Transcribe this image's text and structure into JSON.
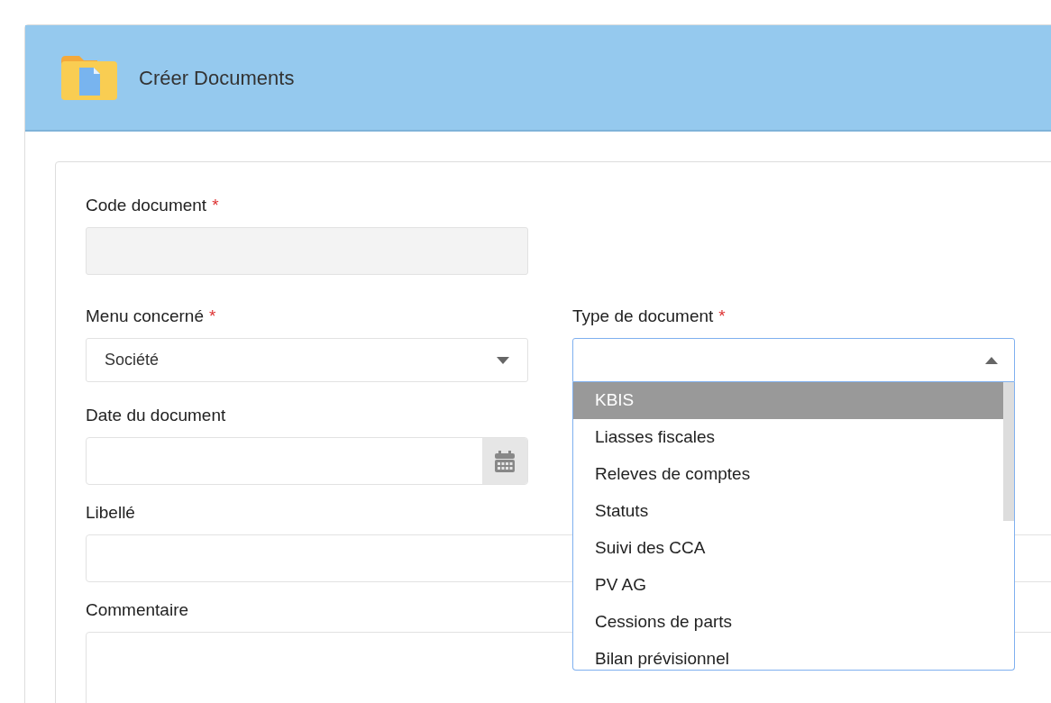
{
  "header": {
    "title": "Créer Documents"
  },
  "form": {
    "code_document": {
      "label": "Code document",
      "required_mark": "*",
      "disabled": true
    },
    "menu_concerne": {
      "label": "Menu concerné",
      "required_mark": "*",
      "value": "Société",
      "expanded": false
    },
    "type_document": {
      "label": "Type de document",
      "required_mark": "*",
      "expanded": true,
      "options": [
        {
          "label": "KBIS",
          "selected": true
        },
        {
          "label": "Liasses fiscales",
          "selected": false
        },
        {
          "label": "Releves de comptes",
          "selected": false
        },
        {
          "label": "Statuts",
          "selected": false
        },
        {
          "label": "Suivi des CCA",
          "selected": false
        },
        {
          "label": "PV AG",
          "selected": false
        },
        {
          "label": "Cessions de parts",
          "selected": false
        },
        {
          "label": "Bilan prévisionnel",
          "selected": false
        }
      ]
    },
    "date_document": {
      "label": "Date du document"
    },
    "libelle": {
      "label": "Libellé"
    },
    "commentaire": {
      "label": "Commentaire"
    }
  }
}
